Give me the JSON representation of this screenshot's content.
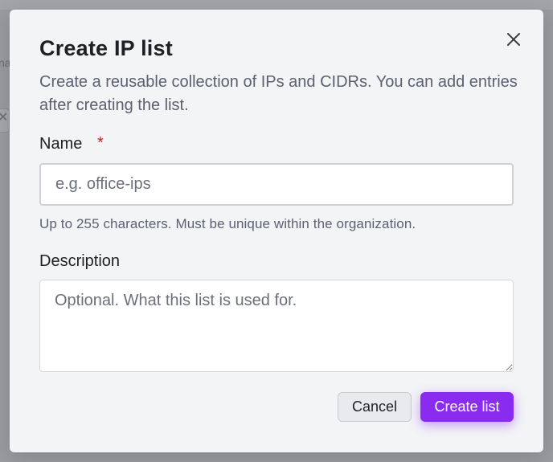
{
  "backdrop": {
    "left_fragment_text": "na",
    "left_close_glyph": "✕"
  },
  "dialog": {
    "title": "Create IP list",
    "description": "Create a reusable collection of IPs and CIDRs. You can add entries after creating the list.",
    "close_icon": "close-icon",
    "name_field": {
      "label": "Name",
      "required_marker": "*",
      "value": "",
      "placeholder": "e.g. office-ips",
      "hint": "Up to 255 characters. Must be unique within the organization."
    },
    "description_field": {
      "label": "Description",
      "value": "",
      "placeholder": "Optional. What this list is used for."
    },
    "actions": {
      "cancel_label": "Cancel",
      "create_label": "Create list"
    }
  },
  "colors": {
    "accent": "#8a2cf0",
    "required": "#d91c1c",
    "dialog_bg": "#f3f4f6",
    "overlay": "#9a9b9e"
  }
}
